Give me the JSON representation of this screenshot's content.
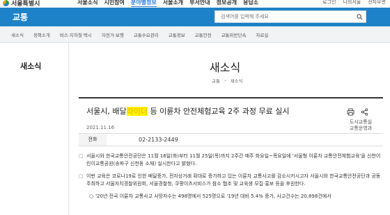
{
  "header": {
    "logo_text": "서울특별시",
    "gnb": [
      "서울소식",
      "시민참여",
      "분야별정보",
      "서울소개",
      "부서안내",
      "정보공개",
      "응답소"
    ],
    "gnb_active_index": 2,
    "util": [
      "로그인",
      "나의서울",
      "전자우편"
    ]
  },
  "section": {
    "title": "교통",
    "search_placeholder": "검색어를 입력해 주세요"
  },
  "subnav": [
    "새소식",
    "정책소개",
    "버스·지하철·택시",
    "자전거·보행",
    "교통수요관리",
    "교통정보",
    "교통안전",
    "교통위반단속",
    "자료실"
  ],
  "left": {
    "title": "새소식"
  },
  "page": {
    "title": "새소식",
    "breadcrumb": [
      "교통",
      "새소식"
    ]
  },
  "article": {
    "title_before": "서울시, 배달",
    "title_highlight": "라이더",
    "title_after": " 등 이륜차 안전체험교육 2주 과정 무료 실시",
    "date": "2021.11.16",
    "dept_line1": "도시교통실",
    "dept_line2": "교통운영과",
    "phone_label": "전화",
    "phone_value": "02-2133-2449",
    "paragraphs": [
      "서울시와 한국교통안전공단은 11월 16일(화)부터 11월 25일(목)까지 2주간 매주 화요일~목요일에 '서울형 이륜차 교통안전체험교육'을 신천어린이교통공원(송파구 신천동 소재) 실시한다고 밝혔다.",
      "이번 교육은 코로나19로 인한 배달증가, 전자상거래 확대로 증가하고 있는 이륜차 교통사고를 감소시키시고자 서울시와 한국교통안전공단과 공동 주최하고 서울자치경찰위원회, 서울경찰청, 쿠팡이츠서비스가 참소 협조 및 교육생 모집·홍보 등을 후원한다."
    ],
    "sub_item": "'20년 전국 이륜차 교통사고 사망자수는 498명에서 525명으로 '19년 대비 5.4% 증가, 사고건수는 20,898건에서"
  },
  "colors": {
    "brand_blue": "#1e82c8",
    "highlight": "#fff200",
    "active_menu": "#2b7de0"
  }
}
